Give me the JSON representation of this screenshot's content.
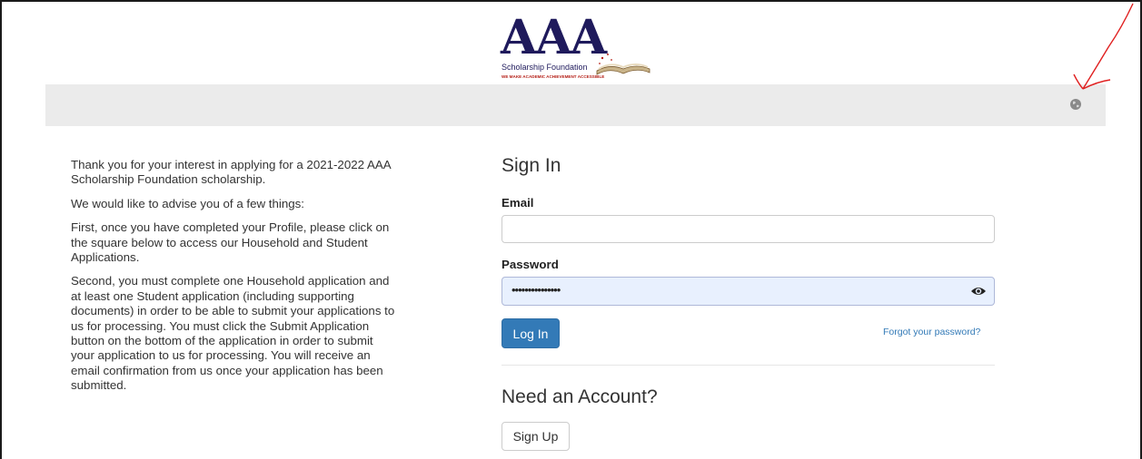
{
  "logo": {
    "letters": "AAA",
    "name": "Scholarship Foundation",
    "tagline": "WE MAKE ACADEMIC ACHIEVEMENT ACCESSIBLE"
  },
  "header": {
    "language_icon": "globe-icon"
  },
  "intro": {
    "paragraphs": [
      "Thank you for your interest in applying for a 2021-2022 AAA Scholarship Foundation scholarship.",
      "We would like to advise you of a few things:",
      "First, once you have completed your Profile, please click on the square below to access our Household and Student Applications.",
      "Second, you must complete one Household application and at least one Student application (including supporting documents) in order to be able to submit your applications to us for processing. You must click the Submit Application button on the bottom of the application in order to submit your application to us for processing. You will receive an email confirmation from us once your application has been submitted."
    ]
  },
  "signin": {
    "heading": "Sign In",
    "email_label": "Email",
    "email_value": "",
    "password_label": "Password",
    "password_value": "•••••••••••••••",
    "login_label": "Log In",
    "forgot_label": "Forgot your password?"
  },
  "signup": {
    "heading": "Need an Account?",
    "button_label": "Sign Up"
  },
  "colors": {
    "primary": "#337ab7",
    "logo_navy": "#1f1a5c",
    "logo_red": "#b52018",
    "header_bar": "#ebebeb",
    "autofill": "#e8f0fe",
    "annotation": "#e02020"
  }
}
